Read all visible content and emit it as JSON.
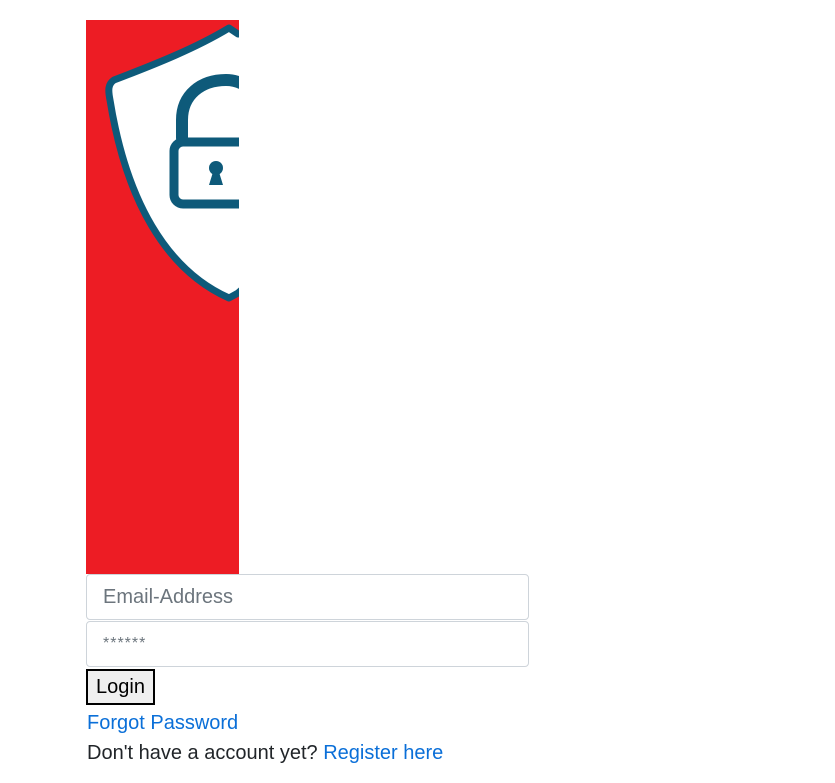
{
  "hero": {
    "icon": "shield-lock-icon",
    "background_color": "#ed1c24",
    "icon_color": "#0e5a7a"
  },
  "login_form": {
    "email_placeholder": "Email-Address",
    "password_placeholder": "******",
    "login_label": "Login",
    "forgot_password_label": "Forgot Password",
    "no_account_text": "Don't have a account yet?",
    "register_label": "Register here"
  },
  "colors": {
    "link": "#0a6fd8",
    "input_border": "#ced4da"
  }
}
